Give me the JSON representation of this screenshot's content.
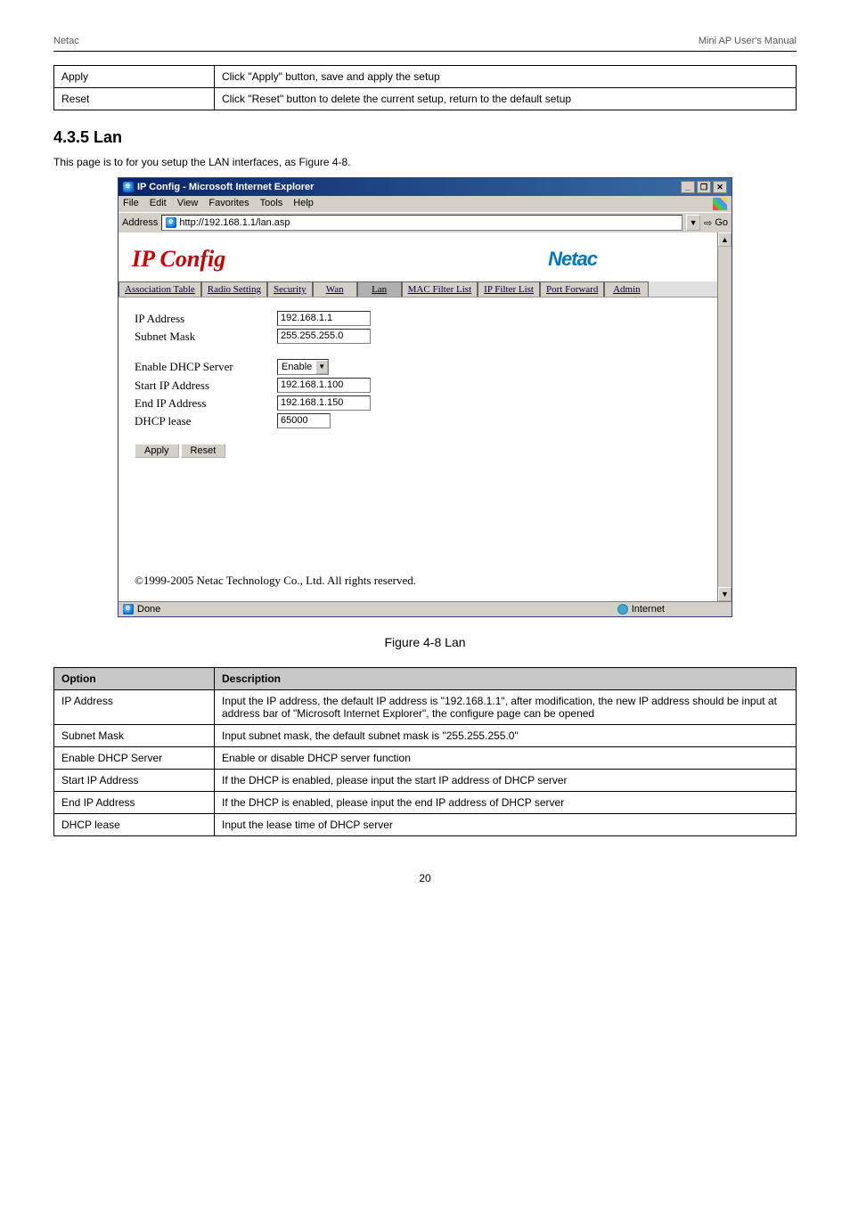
{
  "pageHeader": {
    "left": "Netac",
    "right": "Mini AP User's Manual"
  },
  "topTable": [
    {
      "option": "Apply",
      "desc": "Click \"Apply\" button, save and apply the setup"
    },
    {
      "option": "Reset",
      "desc": "Click \"Reset\" button to delete the current setup, return to the default setup"
    }
  ],
  "section": {
    "title": "4.3.5 Lan",
    "desc": "This page is to for you setup the LAN interfaces, as Figure 4-8."
  },
  "browser": {
    "title": "IP Config - Microsoft Internet Explorer",
    "menu": [
      "File",
      "Edit",
      "View",
      "Favorites",
      "Tools",
      "Help"
    ],
    "addressLabel": "Address",
    "addressUrl": "http://192.168.1.1/lan.asp",
    "goLabel": "Go",
    "statusLeft": "Done",
    "statusRight": "Internet"
  },
  "page": {
    "title": "IP Config",
    "logo": "Netac",
    "tabs": [
      {
        "label": "Association Table",
        "active": false
      },
      {
        "label": "Radio Setting",
        "active": false
      },
      {
        "label": "Security",
        "active": false
      },
      {
        "label": "Wan",
        "active": false
      },
      {
        "label": "Lan",
        "active": true
      },
      {
        "label": "MAC Filter List",
        "active": false
      },
      {
        "label": "IP Filter List",
        "active": false
      },
      {
        "label": "Port Forward",
        "active": false
      },
      {
        "label": "Admin",
        "active": false
      }
    ],
    "form": {
      "ipAddressLabel": "IP Address",
      "ipAddressValue": "192.168.1.1",
      "subnetLabel": "Subnet Mask",
      "subnetValue": "255.255.255.0",
      "dhcpEnableLabel": "Enable DHCP Server",
      "dhcpEnableValue": "Enable",
      "startIpLabel": "Start IP Address",
      "startIpValue": "192.168.1.100",
      "endIpLabel": "End IP Address",
      "endIpValue": "192.168.1.150",
      "leaseLabel": "DHCP lease",
      "leaseValue": "65000",
      "applyBtn": "Apply",
      "resetBtn": "Reset"
    },
    "copyright": "©1999-2005 Netac Technology Co., Ltd. All rights reserved."
  },
  "figureCaption": "Figure 4-8 Lan",
  "lowerTable": {
    "headers": [
      "Option",
      "Description"
    ],
    "rows": [
      {
        "option": "IP Address",
        "desc": "Input the IP address, the default IP address is \"192.168.1.1\", after modification, the new IP address should be input at address bar of \"Microsoft Internet Explorer\", the configure page can be opened"
      },
      {
        "option": "Subnet Mask",
        "desc": "Input subnet mask, the default subnet mask is \"255.255.255.0\""
      },
      {
        "option": "Enable DHCP Server",
        "desc": "Enable or disable DHCP server function"
      },
      {
        "option": "Start IP Address",
        "desc": "If the DHCP is enabled, please input the start IP address of DHCP server"
      },
      {
        "option": "End IP Address",
        "desc": "If the DHCP is enabled, please input the end IP address of DHCP server"
      },
      {
        "option": "DHCP lease",
        "desc": "Input the lease time of DHCP server"
      }
    ]
  },
  "pageNumber": "20"
}
